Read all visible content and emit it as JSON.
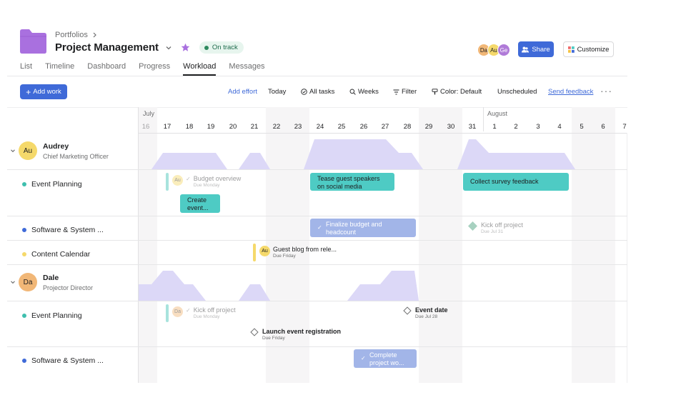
{
  "header": {
    "breadcrumb": "Portfolios",
    "title": "Project Management",
    "status": "On track",
    "avatars": [
      {
        "initials": "Da",
        "color": "#f1b777"
      },
      {
        "initials": "Au",
        "color": "#f5d96b"
      },
      {
        "initials": "Ge",
        "color": "#b07bd8"
      }
    ],
    "share_label": "Share",
    "customize_label": "Customize",
    "folder_color": "#a970df"
  },
  "tabs": [
    {
      "label": "List",
      "active": false
    },
    {
      "label": "Timeline",
      "active": false
    },
    {
      "label": "Dashboard",
      "active": false
    },
    {
      "label": "Progress",
      "active": false
    },
    {
      "label": "Workload",
      "active": true
    },
    {
      "label": "Messages",
      "active": false
    }
  ],
  "toolbar": {
    "add_work": "Add work",
    "add_effort": "Add effort",
    "today": "Today",
    "all_tasks": "All tasks",
    "weeks": "Weeks",
    "filter": "Filter",
    "color": "Color: Default",
    "unscheduled": "Unscheduled",
    "send_feedback": "Send feedback"
  },
  "timeline": {
    "months": [
      "July",
      "August"
    ],
    "days": [
      "16",
      "17",
      "18",
      "19",
      "20",
      "21",
      "22",
      "23",
      "24",
      "25",
      "26",
      "27",
      "28",
      "29",
      "30",
      "31",
      "1",
      "2",
      "3",
      "4",
      "5",
      "6",
      "7"
    ]
  },
  "people": [
    {
      "name": "Audrey",
      "role": "Chief Marketing Officer",
      "initials": "Au",
      "color": "#f5d96b"
    },
    {
      "name": "Dale",
      "role": "Projector Director",
      "initials": "Da",
      "color": "#f1b777"
    }
  ],
  "projects": [
    {
      "name": "Event Planning",
      "color": "#3fbfae"
    },
    {
      "name": "Software & System ...",
      "color": "#3f6ad8"
    },
    {
      "name": "Content Calendar",
      "color": "#f5d96b"
    },
    {
      "name": "Event Planning",
      "color": "#3fbfae"
    },
    {
      "name": "Software & System ...",
      "color": "#3f6ad8"
    }
  ],
  "tasks": {
    "budget_overview": {
      "title": "Budget overview",
      "due": "Due Monday",
      "assignee": "Au"
    },
    "create_event": "Create event...",
    "tease_guest": "Tease guest speakers on social media",
    "collect_survey": "Collect survey feedback",
    "finalize_budget": "Finalize budget and headcount",
    "kickoff_audrey": {
      "title": "Kick off project",
      "due": "Due Jul 31"
    },
    "guest_blog": {
      "title": "Guest blog from rele...",
      "due": "Due Friday",
      "assignee": "Au"
    },
    "kickoff_dale": {
      "title": "Kick off project",
      "due": "Due Monday",
      "assignee": "Da"
    },
    "event_date": {
      "title": "Event date",
      "due": "Due Jul 28"
    },
    "launch_registration": {
      "title": "Launch event registration",
      "due": "Due Friday"
    },
    "complete_project": "Complete project wo..."
  },
  "colors": {
    "accent": "#3f6ad8",
    "workload": "#dcd8f7",
    "task_green": "#4ecbc4",
    "task_blue": "#a2b5e8"
  }
}
